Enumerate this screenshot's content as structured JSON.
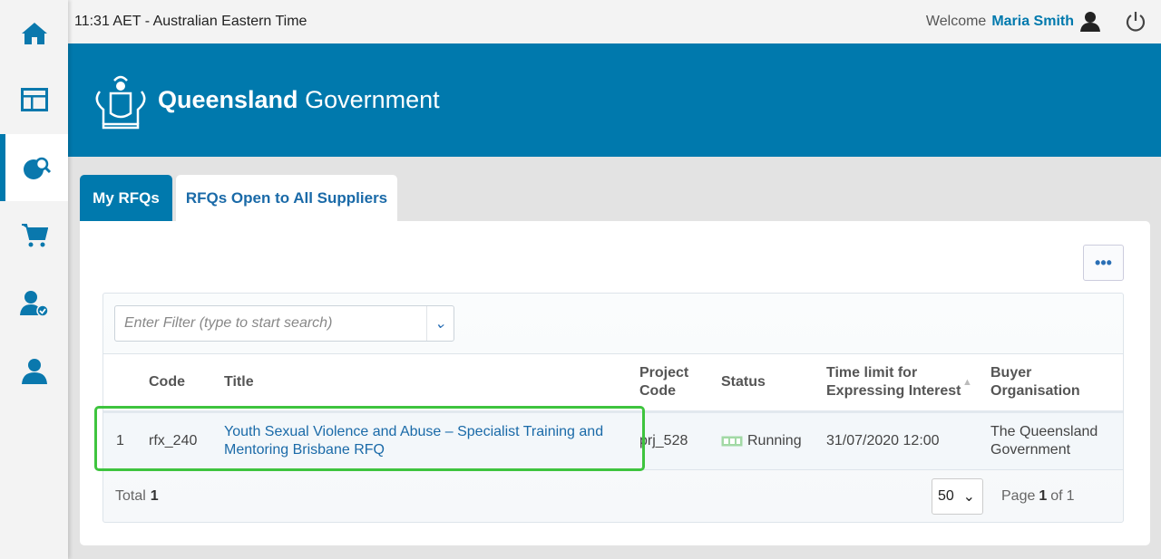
{
  "topbar": {
    "time": "11:31 AET - Australian Eastern Time",
    "welcome": "Welcome",
    "user": "Maria Smith"
  },
  "banner": {
    "logo_bold": "Queensland",
    "logo_light": "Government"
  },
  "tabs": [
    {
      "label": "My RFQs"
    },
    {
      "label": "RFQs Open to All Suppliers"
    }
  ],
  "toolbar": {
    "more_label": "•••"
  },
  "filter": {
    "placeholder": "Enter Filter (type to start search)"
  },
  "table": {
    "headers": {
      "code": "Code",
      "title": "Title",
      "project": "Project Code",
      "status": "Status",
      "time": "Time limit for Expressing Interest",
      "buyer": "Buyer Organisation"
    },
    "rows": [
      {
        "num": "1",
        "code": "rfx_240",
        "title": "Youth Sexual Violence and Abuse – Specialist Training and Mentoring Brisbane RFQ",
        "project": "prj_528",
        "status": "Running",
        "time": "31/07/2020 12:00",
        "buyer": "The Queensland Government"
      }
    ]
  },
  "footer": {
    "total_label": "Total",
    "total": "1",
    "page_size": "50",
    "page_label": "Page",
    "page": "1",
    "of_label": "of",
    "pages": "1"
  },
  "colors": {
    "brand": "#0079ad",
    "running": "#6cc46c"
  }
}
